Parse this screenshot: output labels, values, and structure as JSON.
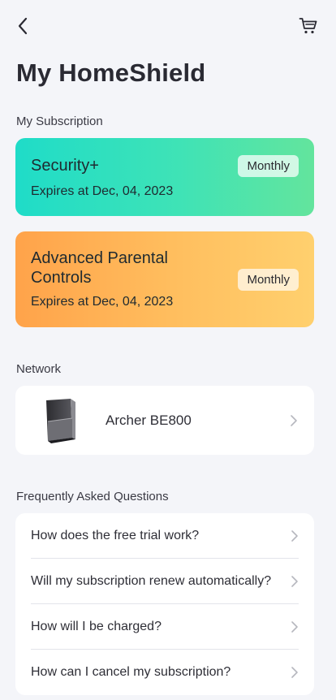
{
  "header": {
    "back_icon": "chevron-left-icon",
    "cart_icon": "shopping-cart-icon"
  },
  "page_title": "My HomeShield",
  "subscription": {
    "section_label": "My Subscription",
    "plans": [
      {
        "name": "Security+",
        "billing": "Monthly",
        "expiry": "Expires at Dec, 04, 2023",
        "gradient": [
          "#1fdcc8",
          "#63e49d"
        ]
      },
      {
        "name": "Advanced Parental Controls",
        "billing": "Monthly",
        "expiry": "Expires at Dec, 04, 2023",
        "gradient": [
          "#ffa34a",
          "#ffd06e"
        ]
      }
    ]
  },
  "network": {
    "section_label": "Network",
    "device": {
      "name": "Archer BE800",
      "icon": "router-icon"
    }
  },
  "faq": {
    "section_label": "Frequently Asked Questions",
    "items": [
      {
        "question": "How does the free trial work?"
      },
      {
        "question": "Will my subscription renew automatically?"
      },
      {
        "question": "How will I be charged?"
      },
      {
        "question": "How can I cancel my subscription?"
      }
    ]
  },
  "colors": {
    "background": "#f4f5f9",
    "card": "#ffffff",
    "text": "#2b2b33"
  }
}
